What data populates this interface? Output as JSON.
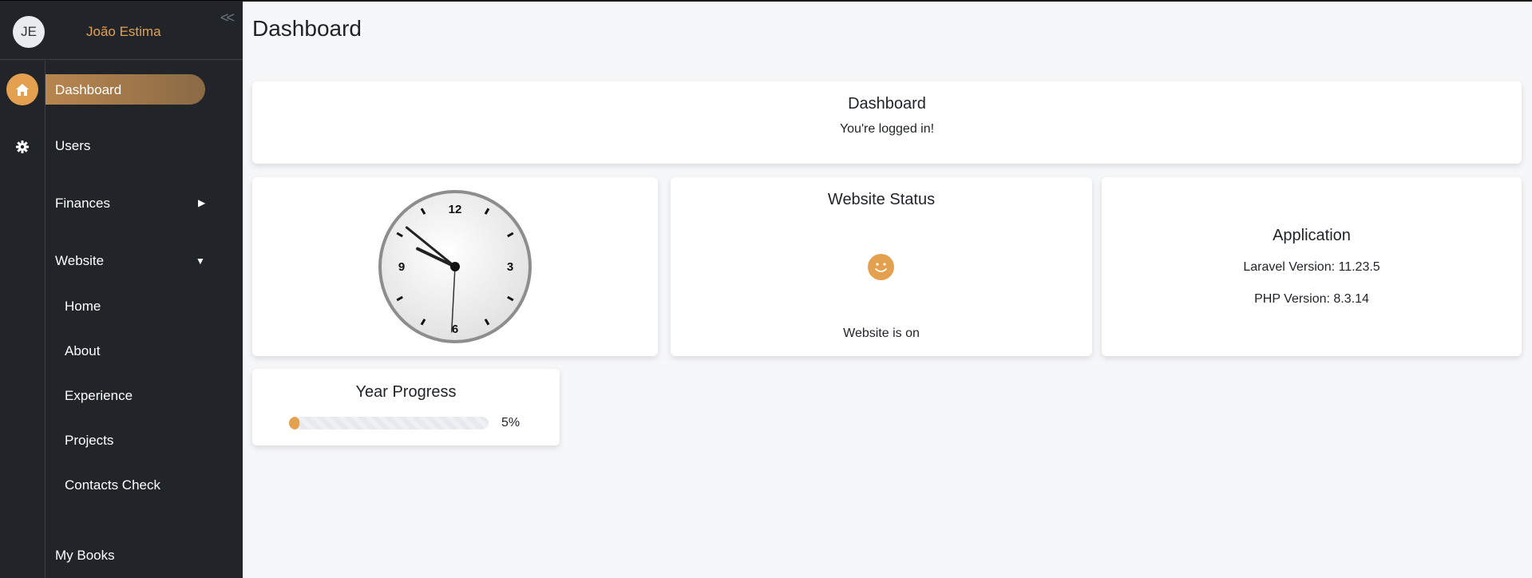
{
  "user": {
    "initials": "JE",
    "name": "João Estima"
  },
  "sidebar": {
    "collapse_icon": "double-chevron-left-icon",
    "rail_icons": [
      "home-icon",
      "gear-icon"
    ],
    "items": [
      {
        "label": "Dashboard",
        "active": true
      },
      {
        "label": "Users"
      },
      {
        "label": "Finances",
        "caret": "right"
      },
      {
        "label": "Website",
        "caret": "down"
      },
      {
        "label": "Home"
      },
      {
        "label": "About"
      },
      {
        "label": "Experience"
      },
      {
        "label": "Projects"
      },
      {
        "label": "Contacts Check"
      },
      {
        "label": "My Books"
      }
    ]
  },
  "page": {
    "title": "Dashboard"
  },
  "welcome": {
    "title": "Dashboard",
    "message": "You're logged in!"
  },
  "clock": {
    "hours": 9,
    "minutes": 51,
    "seconds": 30,
    "numbers": [
      "12",
      "3",
      "6",
      "9"
    ]
  },
  "status": {
    "title": "Website Status",
    "icon": "smiley-icon",
    "text": "Website is on"
  },
  "application": {
    "title": "Application",
    "laravel": "Laravel Version: 11.23.5",
    "php": "PHP Version: 8.3.14"
  },
  "year_progress": {
    "title": "Year Progress",
    "percent": 5,
    "label": "5%"
  },
  "colors": {
    "accent": "#e3a04f",
    "sidebar_bg": "#212529",
    "page_bg": "#f6f7f9"
  }
}
